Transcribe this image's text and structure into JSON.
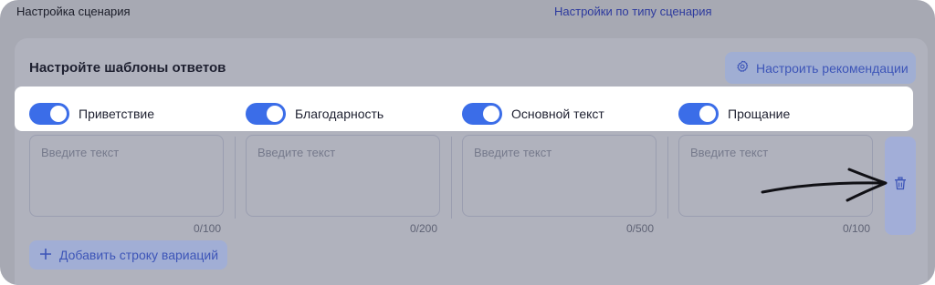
{
  "header": {
    "left_title": "Настройка сценария",
    "right_link": "Настройки по типу сценария"
  },
  "templates": {
    "title": "Настройте шаблоны ответов",
    "recommendations_button": "Настроить рекомендации",
    "toggles": [
      {
        "label": "Приветствие",
        "on": true
      },
      {
        "label": "Благодарность",
        "on": true
      },
      {
        "label": "Основной текст",
        "on": true
      },
      {
        "label": "Прощание",
        "on": true
      }
    ],
    "fields": [
      {
        "placeholder": "Введите текст",
        "counter": "0/100"
      },
      {
        "placeholder": "Введите текст",
        "counter": "0/200"
      },
      {
        "placeholder": "Введите текст",
        "counter": "0/500"
      },
      {
        "placeholder": "Введите текст",
        "counter": "0/100"
      }
    ],
    "add_row_button": "Добавить строку вариаций"
  },
  "icons": {
    "recommendations": "gear-icon",
    "add": "plus-icon",
    "delete": "trash-icon"
  },
  "colors": {
    "accent": "#3b6de8",
    "link": "#2d3a9e",
    "overlay": "#a7a9b3"
  }
}
